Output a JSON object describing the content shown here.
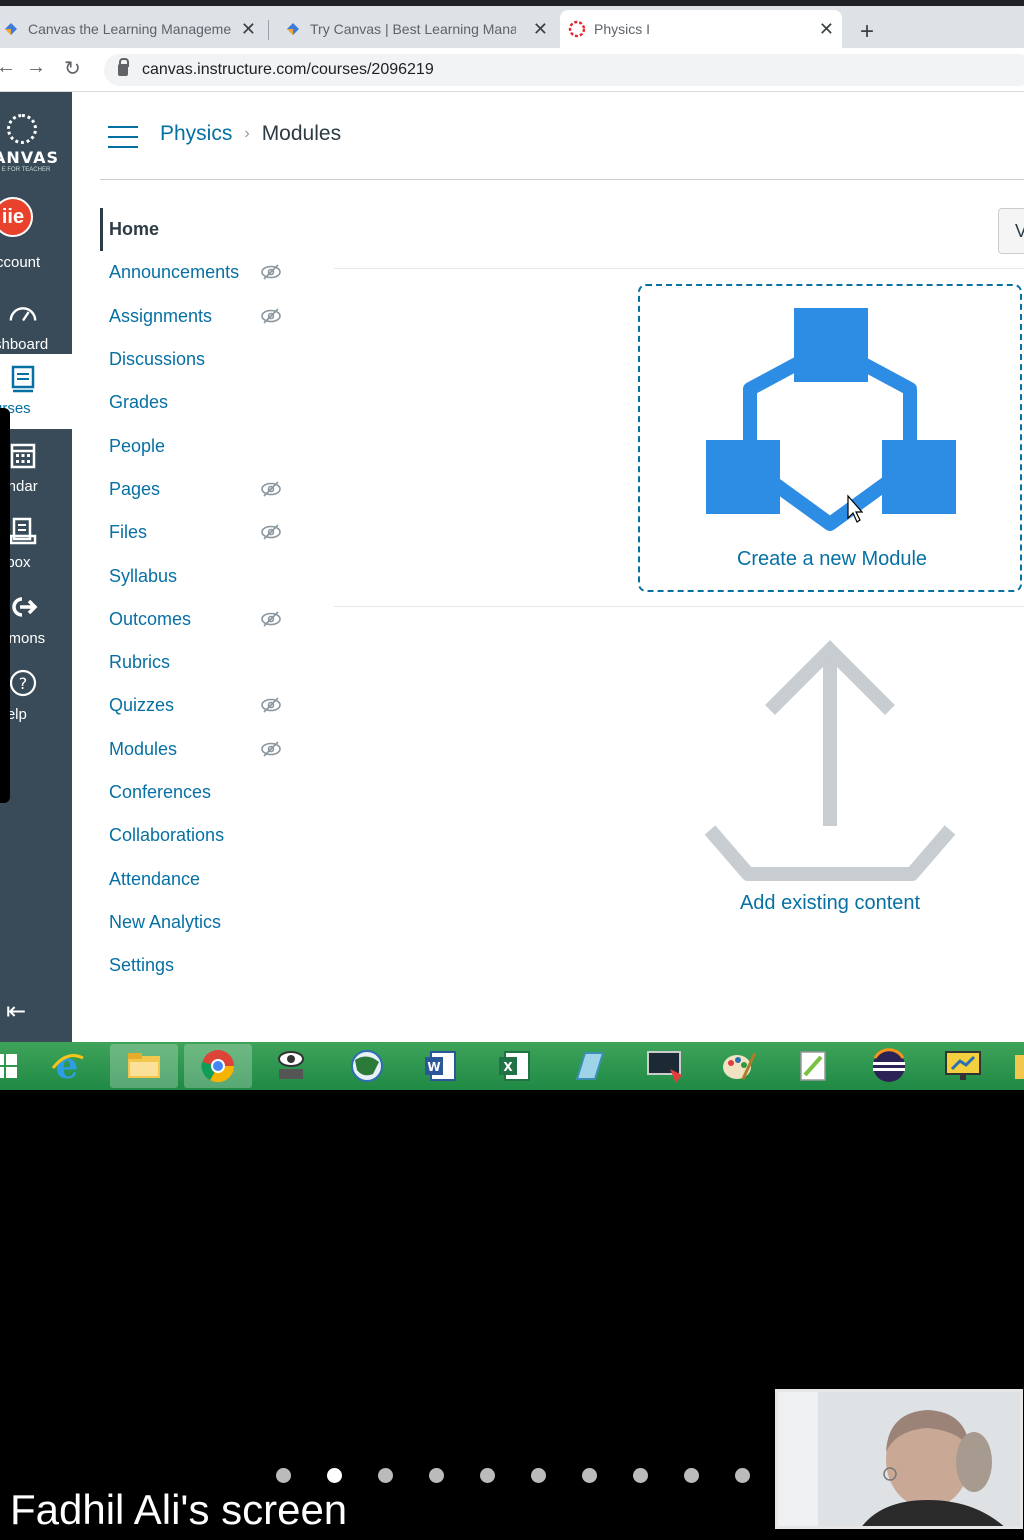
{
  "browser": {
    "tabs": [
      {
        "title": "Canvas the Learning Manageme",
        "close": "✕"
      },
      {
        "title": "Try Canvas | Best Learning Mana",
        "close": "✕"
      },
      {
        "title": "Physics I",
        "close": "✕"
      }
    ],
    "new_tab": "+",
    "url": "canvas.instructure.com/courses/2096219"
  },
  "global_nav": {
    "logo_text": "ANVAS",
    "logo_sub": "E FOR TEACHER",
    "avatar_text": "iie",
    "items": [
      {
        "label": "ccount",
        "icon": "account-avatar-icon"
      },
      {
        "label": "shboard",
        "icon": "dashboard-icon"
      },
      {
        "label": "urses",
        "icon": "courses-icon"
      },
      {
        "label": "lendar",
        "icon": "calendar-icon"
      },
      {
        "label": "nbox",
        "icon": "inbox-icon"
      },
      {
        "label": "mmons",
        "icon": "commons-icon"
      },
      {
        "label": "Help",
        "icon": "help-icon"
      }
    ]
  },
  "breadcrumb": {
    "course": "Physics",
    "separator": "›",
    "current": "Modules"
  },
  "course_nav": {
    "items": [
      {
        "label": "Home",
        "hidden": false
      },
      {
        "label": "Announcements",
        "hidden": true
      },
      {
        "label": "Assignments",
        "hidden": true
      },
      {
        "label": "Discussions",
        "hidden": false
      },
      {
        "label": "Grades",
        "hidden": false
      },
      {
        "label": "People",
        "hidden": false
      },
      {
        "label": "Pages",
        "hidden": true
      },
      {
        "label": "Files",
        "hidden": true
      },
      {
        "label": "Syllabus",
        "hidden": false
      },
      {
        "label": "Outcomes",
        "hidden": true
      },
      {
        "label": "Rubrics",
        "hidden": false
      },
      {
        "label": "Quizzes",
        "hidden": true
      },
      {
        "label": "Modules",
        "hidden": true
      },
      {
        "label": "Conferences",
        "hidden": false
      },
      {
        "label": "Collaborations",
        "hidden": false
      },
      {
        "label": "Attendance",
        "hidden": false
      },
      {
        "label": "New Analytics",
        "hidden": false
      },
      {
        "label": "Settings",
        "hidden": false
      }
    ]
  },
  "main": {
    "top_button": "V",
    "create_module": "Create a new Module",
    "add_existing": "Add existing content"
  },
  "meeting": {
    "presenter": "Fadhil Ali's screen",
    "page_dots": 10,
    "active_dot": 1
  },
  "colors": {
    "canvas_blue": "#0770a3",
    "module_blue": "#2d8ce3",
    "nav_dark": "#394b58",
    "taskbar_green": "#2b9a4f"
  }
}
